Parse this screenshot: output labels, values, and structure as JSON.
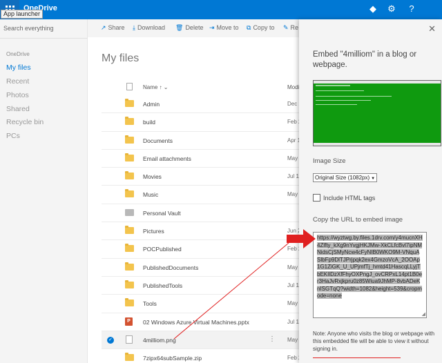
{
  "topbar": {
    "brand": "OneDrive",
    "tooltip": "App launcher",
    "icons": [
      "diamond-icon",
      "gear-icon",
      "help-icon"
    ]
  },
  "leftnav": {
    "search_placeholder": "Search everything",
    "section": "OneDrive",
    "items": [
      "My files",
      "Recent",
      "Photos",
      "Shared",
      "Recycle bin",
      "PCs"
    ]
  },
  "commands": {
    "share": "Share",
    "download": "Download",
    "delete": "Delete",
    "move": "Move to",
    "copy": "Copy to",
    "rename": "Re"
  },
  "main": {
    "title": "My files",
    "col_name": "Name",
    "col_modified": "Modi",
    "rows": [
      {
        "name": "Admin",
        "date": "Dec 2",
        "type": "folder"
      },
      {
        "name": "build",
        "date": "Feb 2",
        "type": "folder"
      },
      {
        "name": "Documents",
        "date": "Apr 1",
        "type": "folder"
      },
      {
        "name": "Email attachments",
        "date": "May",
        "type": "folder"
      },
      {
        "name": "Movies",
        "date": "Jul 15",
        "type": "folder"
      },
      {
        "name": "Music",
        "date": "May",
        "type": "folder"
      },
      {
        "name": "Personal Vault",
        "date": "",
        "type": "vault"
      },
      {
        "name": "Pictures",
        "date": "Jun 2",
        "type": "folder"
      },
      {
        "name": "POCPublished",
        "date": "Feb 2",
        "type": "folder"
      },
      {
        "name": "PublishedDocuments",
        "date": "May",
        "type": "folder"
      },
      {
        "name": "PublishedTools",
        "date": "Jul 19",
        "type": "folder"
      },
      {
        "name": "Tools",
        "date": "May",
        "type": "folder"
      },
      {
        "name": "02 Windows Azure Virtual Machines.pptx",
        "date": "Jul 19",
        "type": "ppt"
      },
      {
        "name": "4milliom.png",
        "date": "May",
        "type": "image"
      },
      {
        "name": "7zipx64subSample.zip",
        "date": "Feb 2",
        "type": "folder"
      }
    ]
  },
  "panel": {
    "title": "Embed \"4milliom\" in a blog or webpage.",
    "image_size_label": "Image Size",
    "image_size_value": "Original Size (1082px)",
    "include_html_label": "Include HTML tags",
    "url_label": "Copy the URL to embed image",
    "url": "https://wyztwg.by.files.1drv.com/y4mucnXH4Zlfty_kXg9nYvgjHKJMw-XkCLfcBvl7ipNMNidsCjSMyNcw4cFyNIB0WKO9M-VNquASlbFp9DlTJPrjpqk2ex4GmzoVcA_2OOAp1G1ZiGK_U_UPjmfTj_hmtd41HascqLLyjTbEKIlDzXfFhyOXPngJ_ovCRPxL14pt1B0er3HaJvRxjkpru0z85Wiua9JhMP-8vbADeKnISGTqQ?width=1082&height=539&cropmode=none",
    "note": "Note: Anyone who visits the blog or webpage with this embedded file will be able to view it without signing in."
  },
  "colors": {
    "brand_blue": "#0078d4",
    "folder_yellow": "#f3c44d",
    "annotation_red": "#e02020"
  }
}
